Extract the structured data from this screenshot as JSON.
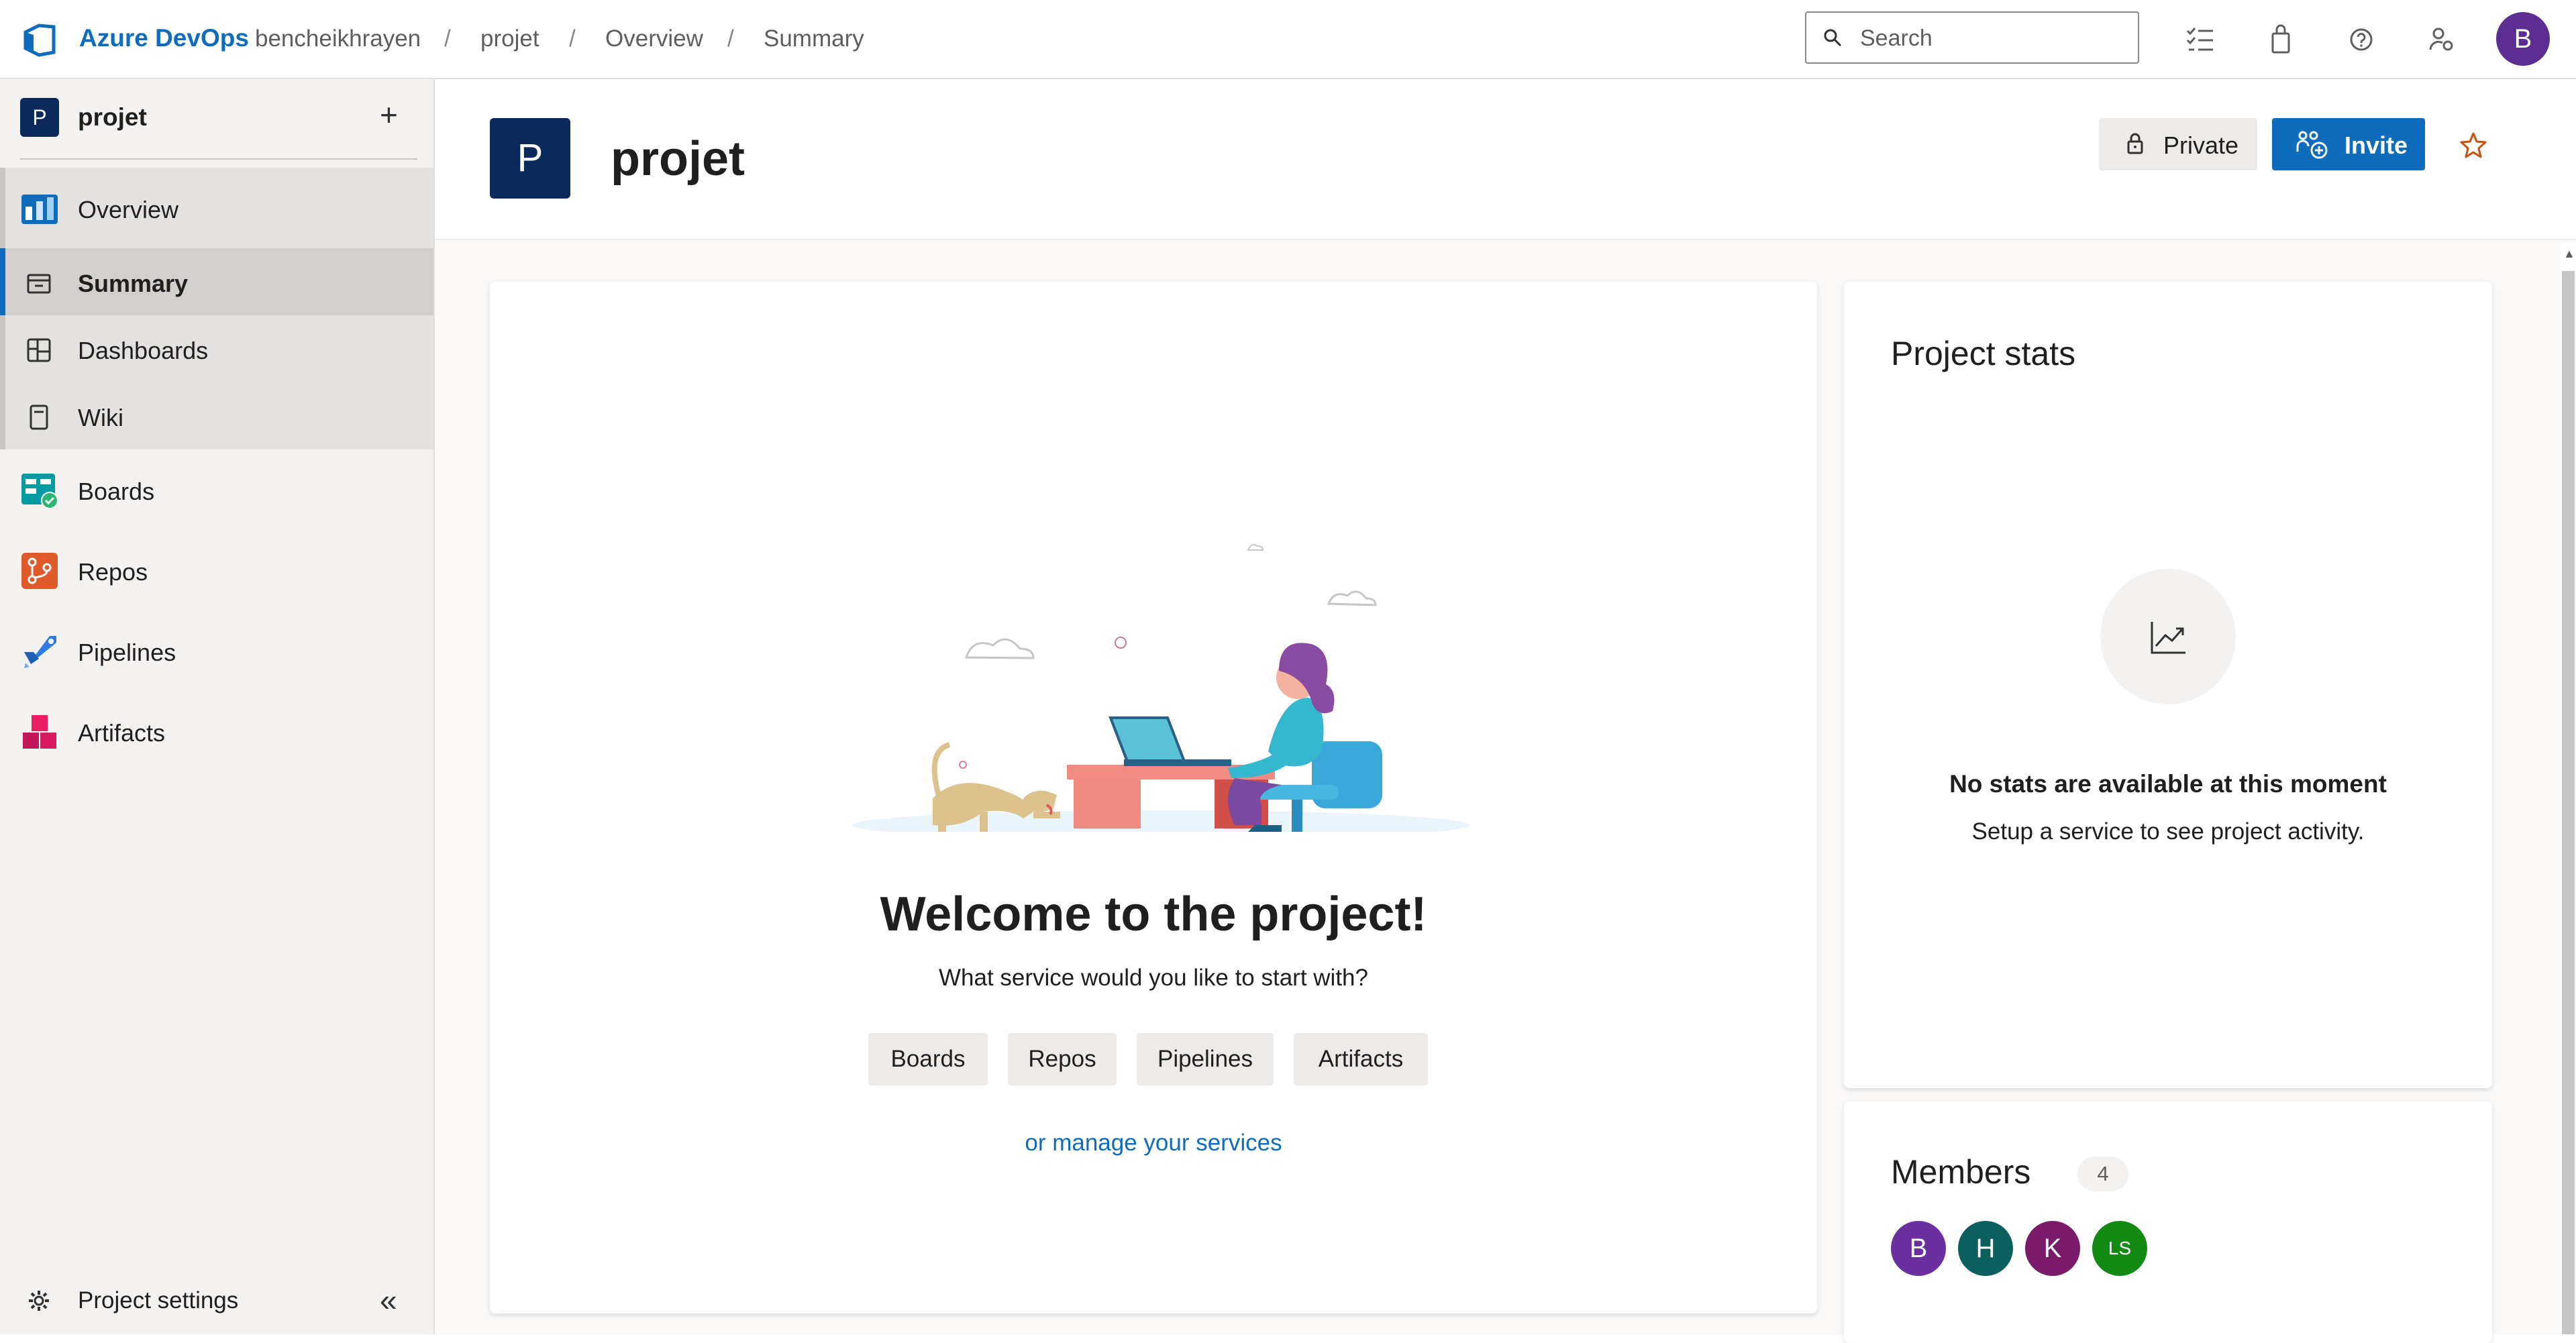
{
  "topbar": {
    "brand": "Azure DevOps",
    "breadcrumbs": [
      "bencheikhrayen",
      "projet",
      "Overview",
      "Summary"
    ],
    "separator": "/",
    "search_placeholder": "Search",
    "avatar_initial": "B",
    "icons": [
      "work-items-icon",
      "marketplace-bag-icon",
      "help-icon",
      "user-settings-icon"
    ]
  },
  "sidebar": {
    "project_initial": "P",
    "project_name": "projet",
    "add_symbol": "+",
    "items": [
      {
        "label": "Overview",
        "icon": "overview-icon"
      },
      {
        "label": "Summary",
        "icon": "summary-icon",
        "selected": true
      },
      {
        "label": "Dashboards",
        "icon": "dashboards-icon"
      },
      {
        "label": "Wiki",
        "icon": "wiki-icon"
      },
      {
        "label": "Boards",
        "icon": "boards-icon"
      },
      {
        "label": "Repos",
        "icon": "repos-icon"
      },
      {
        "label": "Pipelines",
        "icon": "pipelines-icon"
      },
      {
        "label": "Artifacts",
        "icon": "artifacts-icon"
      }
    ],
    "settings_label": "Project settings",
    "collapse_symbol": "«"
  },
  "header": {
    "project_initial": "P",
    "title": "projet",
    "private_label": "Private",
    "invite_label": "Invite"
  },
  "welcome": {
    "title": "Welcome to the project!",
    "subtitle": "What service would you like to start with?",
    "services": [
      "Boards",
      "Repos",
      "Pipelines",
      "Artifacts"
    ],
    "manage_link": "or manage your services"
  },
  "stats": {
    "title": "Project stats",
    "empty_title": "No stats are available at this moment",
    "empty_sub": "Setup a service to see project activity."
  },
  "members": {
    "title": "Members",
    "count": "4",
    "avatars": [
      {
        "initials": "B",
        "color": "#6b2fa0"
      },
      {
        "initials": "H",
        "color": "#0b5f5f"
      },
      {
        "initials": "K",
        "color": "#7a1a6b"
      },
      {
        "initials": "LS",
        "color": "#138a13"
      }
    ]
  },
  "colors": {
    "accent": "#0f6cbd",
    "project_badge": "#0b2a5b",
    "avatar_top": "#5c2e91"
  }
}
